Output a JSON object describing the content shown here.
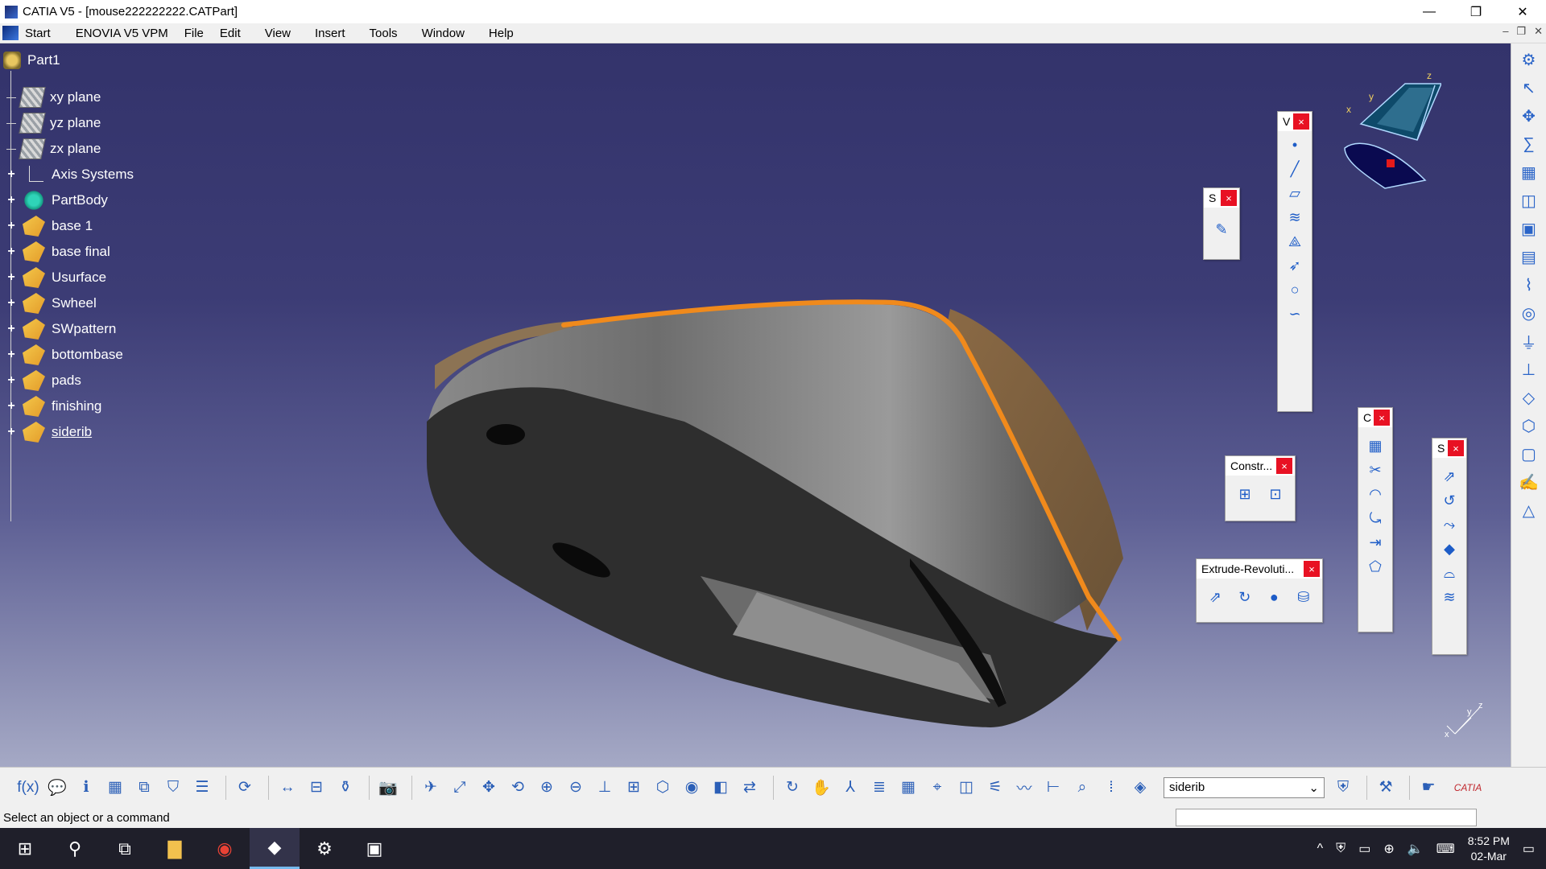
{
  "window": {
    "title": "CATIA V5 - [mouse222222222.CATPart]",
    "controls": [
      "—",
      "❐",
      "✕"
    ]
  },
  "menu": {
    "items": [
      "Start",
      "ENOVIA V5 VPM",
      "File",
      "Edit",
      "View",
      "Insert",
      "Tools",
      "Window",
      "Help"
    ]
  },
  "tree": {
    "root": "Part1",
    "items": [
      {
        "label": "xy plane",
        "icon": "plane-icon",
        "expandable": false
      },
      {
        "label": "yz plane",
        "icon": "plane-icon",
        "expandable": false
      },
      {
        "label": "zx plane",
        "icon": "plane-icon",
        "expandable": false
      },
      {
        "label": "Axis Systems",
        "icon": "axis-icon",
        "expandable": true
      },
      {
        "label": "PartBody",
        "icon": "body-icon",
        "expandable": true
      },
      {
        "label": "base 1",
        "icon": "geometrical-set-icon",
        "expandable": true
      },
      {
        "label": "base final",
        "icon": "geometrical-set-icon",
        "expandable": true
      },
      {
        "label": "Usurface",
        "icon": "geometrical-set-icon",
        "expandable": true
      },
      {
        "label": "Swheel",
        "icon": "geometrical-set-icon",
        "expandable": true
      },
      {
        "label": "SWpattern",
        "icon": "geometrical-set-icon",
        "expandable": true
      },
      {
        "label": "bottombase",
        "icon": "geometrical-set-icon",
        "expandable": true
      },
      {
        "label": "pads",
        "icon": "geometrical-set-icon",
        "expandable": true
      },
      {
        "label": "finishing",
        "icon": "geometrical-set-icon",
        "expandable": true
      },
      {
        "label": "siderib",
        "icon": "geometrical-set-icon",
        "expandable": true
      }
    ],
    "expand_glyph": "+"
  },
  "compass": {
    "x": "x",
    "y": "y",
    "z": "z"
  },
  "floating_toolbars": {
    "v_title": "V",
    "s1_title": "S",
    "c_title": "C",
    "s2_title": "S",
    "constr_title": "Constr...",
    "extrude_title": "Extrude-Revoluti...",
    "close_glyph": "×"
  },
  "bottom_toolbar": {
    "current_set": "siderib",
    "dropdown_glyph": "⌄",
    "catia_logo": "CATIA"
  },
  "status": {
    "message": "Select an object or a command"
  },
  "taskbar": {
    "time": "8:52 PM",
    "date": "02-Mar"
  },
  "axis_indicator": {
    "x": "x",
    "y": "y",
    "z": "z"
  },
  "colors": {
    "viewport_top": "#33336b",
    "viewport_bottom": "#a5a9c5",
    "edge_highlight": "#f08a1c",
    "close_button": "#e81123"
  }
}
